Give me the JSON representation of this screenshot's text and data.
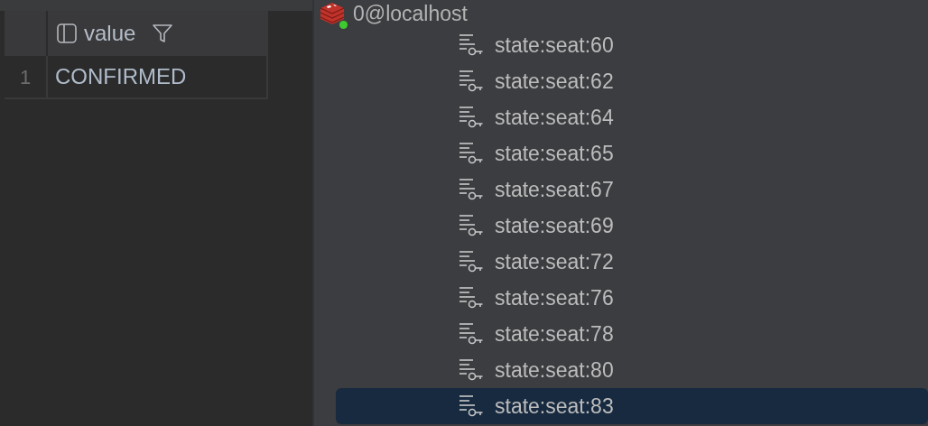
{
  "result_table": {
    "columns": [
      {
        "label": "value"
      }
    ],
    "rows": [
      {
        "line_number": "1",
        "value": "CONFIRMED"
      }
    ]
  },
  "tree": {
    "connection": {
      "label": "0@localhost",
      "connected": true
    },
    "keys": [
      {
        "label": "state:seat:60",
        "selected": false
      },
      {
        "label": "state:seat:62",
        "selected": false
      },
      {
        "label": "state:seat:64",
        "selected": false
      },
      {
        "label": "state:seat:65",
        "selected": false
      },
      {
        "label": "state:seat:67",
        "selected": false
      },
      {
        "label": "state:seat:69",
        "selected": false
      },
      {
        "label": "state:seat:72",
        "selected": false
      },
      {
        "label": "state:seat:76",
        "selected": false
      },
      {
        "label": "state:seat:78",
        "selected": false
      },
      {
        "label": "state:seat:80",
        "selected": false
      },
      {
        "label": "state:seat:83",
        "selected": true
      }
    ]
  }
}
